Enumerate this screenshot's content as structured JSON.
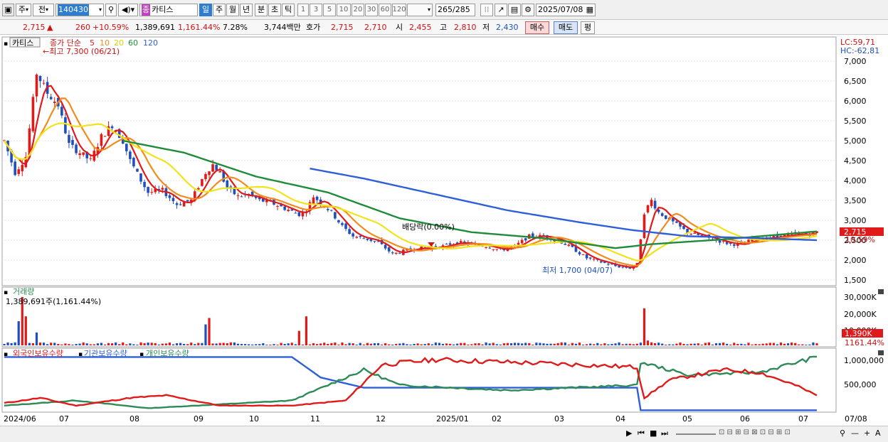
{
  "toolbar": {
    "market_label": "주",
    "prev_label": "전",
    "code_value": "140430",
    "type_badge": "종",
    "stock_name": "카티스",
    "periods": [
      "일",
      "주",
      "월",
      "년",
      "분",
      "초",
      "틱"
    ],
    "active_period": "일",
    "intervals": [
      "1",
      "3",
      "5",
      "10",
      "20",
      "30",
      "60",
      "120"
    ],
    "count_current": "265",
    "count_total": "/285",
    "date_value": "2025/07/08"
  },
  "quote": {
    "price": "2,715",
    "change": "260",
    "change_pct": "+10.59%",
    "volume": "1,389,691",
    "volume_ratio": "1,161.44%",
    "turnover": "7.28%",
    "amount": "3,744백만",
    "ask_label": "호가",
    "ask_price": "2,715",
    "bid_price": "2,710",
    "open_label": "시",
    "open": "2,455",
    "high_label": "고",
    "high": "2,810",
    "low_label": "저",
    "low": "2,430",
    "buy_label": "매수",
    "sell_label": "매도",
    "eval_label": "평"
  },
  "price_panel": {
    "stock_tag": "카티스",
    "ma_title": "종가 단순",
    "ma_periods": [
      "5",
      "10",
      "20",
      "60",
      "120"
    ],
    "ma_colors": [
      "#e01a1a",
      "#f08c1e",
      "#f2e21c",
      "#1f8c3a",
      "#2e5fd8"
    ],
    "high_marker": "←최고 7,300 (06/21)",
    "low_marker": "최저 1,700 (04/07)",
    "dividend_marker": "배당락(0.00%)",
    "lc_label": "LC:59,71",
    "hc_label": "HC:-62,81",
    "price_ticks": [
      "7,000",
      "6,500",
      "6,000",
      "5,500",
      "5,000",
      "4,500",
      "4,000",
      "3,500",
      "3,000",
      "2,500",
      "2,000",
      "1,500"
    ],
    "current_price_tag": "2,715",
    "current_change_tag": "10.59%"
  },
  "volume_panel": {
    "title": "거래량",
    "value_text": "1,389,691주(1,161.44%)",
    "ticks": [
      "30,000K",
      "20,000K",
      "10,000K"
    ],
    "current_tag": "1,390K",
    "current_ratio_tag": "1161.44%"
  },
  "holdings_panel": {
    "legend": [
      "외국인보유수량",
      "기관보유수량",
      "개인보유수량"
    ],
    "colors": [
      "#e01a1a",
      "#2e5fd8",
      "#2e8b57"
    ],
    "ticks": [
      "1,000,000",
      "500,000"
    ]
  },
  "time_axis": {
    "labels": [
      "2024/06",
      "07",
      "08",
      "09",
      "10",
      "11",
      "12",
      "2025/01",
      "02",
      "03",
      "04",
      "05",
      "06",
      "07"
    ],
    "end_label": "07/08"
  },
  "chart_data": {
    "type": "candlestick",
    "period_start": "2024/06",
    "period_end": "2025/07/08",
    "ylim": [
      1500,
      7400
    ],
    "price_path": [
      [
        0,
        5000
      ],
      [
        3,
        4200
      ],
      [
        6,
        4600
      ],
      [
        9,
        6700
      ],
      [
        12,
        6200
      ],
      [
        15,
        5900
      ],
      [
        18,
        4900
      ],
      [
        21,
        4700
      ],
      [
        24,
        4500
      ],
      [
        27,
        5100
      ],
      [
        30,
        5400
      ],
      [
        33,
        5000
      ],
      [
        35,
        4500
      ],
      [
        38,
        4000
      ],
      [
        40,
        3700
      ],
      [
        44,
        3750
      ],
      [
        48,
        3400
      ],
      [
        52,
        3500
      ],
      [
        56,
        4200
      ],
      [
        58,
        4400
      ],
      [
        60,
        4200
      ],
      [
        62,
        3800
      ],
      [
        65,
        3600
      ],
      [
        68,
        3650
      ],
      [
        71,
        3500
      ],
      [
        74,
        3450
      ],
      [
        78,
        3300
      ],
      [
        82,
        3150
      ],
      [
        84,
        3250
      ],
      [
        86,
        3600
      ],
      [
        88,
        3450
      ],
      [
        91,
        3200
      ],
      [
        94,
        2850
      ],
      [
        97,
        2600
      ],
      [
        100,
        2550
      ],
      [
        104,
        2450
      ],
      [
        108,
        2150
      ],
      [
        110,
        2200
      ],
      [
        114,
        2300
      ],
      [
        118,
        2300
      ],
      [
        122,
        2350
      ],
      [
        126,
        2450
      ],
      [
        130,
        2400
      ],
      [
        134,
        2350
      ],
      [
        138,
        2250
      ],
      [
        142,
        2350
      ],
      [
        146,
        2600
      ],
      [
        150,
        2600
      ],
      [
        154,
        2500
      ],
      [
        158,
        2300
      ],
      [
        162,
        2050
      ],
      [
        166,
        1950
      ],
      [
        170,
        1850
      ],
      [
        174,
        1800
      ],
      [
        176,
        1900
      ],
      [
        178,
        3200
      ],
      [
        180,
        3500
      ],
      [
        182,
        3200
      ],
      [
        186,
        2950
      ],
      [
        190,
        2700
      ],
      [
        194,
        2600
      ],
      [
        198,
        2500
      ],
      [
        202,
        2400
      ],
      [
        206,
        2400
      ],
      [
        208,
        2550
      ],
      [
        212,
        2550
      ],
      [
        216,
        2600
      ],
      [
        220,
        2650
      ],
      [
        224,
        2650
      ],
      [
        226,
        2715
      ]
    ],
    "price_range_ticks": [
      7000,
      6500,
      6000,
      5500,
      5000,
      4500,
      4000,
      3500,
      3000,
      2500,
      2000,
      1500
    ],
    "ma120_path": [
      [
        85,
        4300
      ],
      [
        100,
        4050
      ],
      [
        120,
        3650
      ],
      [
        140,
        3250
      ],
      [
        160,
        2950
      ],
      [
        175,
        2750
      ],
      [
        190,
        2600
      ],
      [
        210,
        2550
      ],
      [
        226,
        2500
      ]
    ],
    "ma60_path": [
      [
        33,
        5000
      ],
      [
        50,
        4700
      ],
      [
        70,
        4100
      ],
      [
        90,
        3700
      ],
      [
        110,
        3050
      ],
      [
        130,
        2700
      ],
      [
        150,
        2550
      ],
      [
        170,
        2300
      ],
      [
        180,
        2400
      ],
      [
        200,
        2520
      ],
      [
        226,
        2720
      ]
    ],
    "volume_spikes_k": [
      [
        4,
        15000
      ],
      [
        5,
        30000
      ],
      [
        6,
        18000
      ],
      [
        9,
        8000
      ],
      [
        56,
        13000
      ],
      [
        57,
        17000
      ],
      [
        82,
        9000
      ],
      [
        84,
        18000
      ],
      [
        178,
        23000
      ],
      [
        179,
        3000
      ]
    ],
    "holdings_ylim": [
      0,
      1100000
    ],
    "foreign_path": [
      [
        0,
        150000
      ],
      [
        10,
        250000
      ],
      [
        20,
        100000
      ],
      [
        35,
        250000
      ],
      [
        45,
        300000
      ],
      [
        60,
        100000
      ],
      [
        80,
        100000
      ],
      [
        95,
        200000
      ],
      [
        105,
        900000
      ],
      [
        120,
        1000000
      ],
      [
        140,
        950000
      ],
      [
        160,
        900000
      ],
      [
        176,
        850000
      ],
      [
        178,
        250000
      ],
      [
        185,
        600000
      ],
      [
        200,
        800000
      ],
      [
        210,
        750000
      ],
      [
        220,
        500000
      ],
      [
        226,
        300000
      ]
    ],
    "institution_path": [
      [
        0,
        1050000
      ],
      [
        80,
        1050000
      ],
      [
        88,
        650000
      ],
      [
        100,
        450000
      ],
      [
        176,
        450000
      ],
      [
        177,
        10000
      ],
      [
        226,
        10000
      ]
    ],
    "individual_path": [
      [
        0,
        100000
      ],
      [
        20,
        200000
      ],
      [
        40,
        50000
      ],
      [
        80,
        200000
      ],
      [
        90,
        500000
      ],
      [
        100,
        800000
      ],
      [
        110,
        500000
      ],
      [
        140,
        400000
      ],
      [
        176,
        500000
      ],
      [
        177,
        950000
      ],
      [
        190,
        700000
      ],
      [
        210,
        750000
      ],
      [
        226,
        1050000
      ]
    ]
  }
}
